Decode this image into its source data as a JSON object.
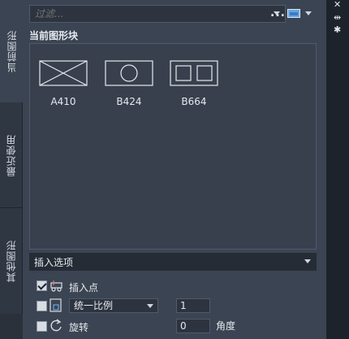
{
  "tabs": [
    "当前图形",
    "最近使用",
    "其他图形"
  ],
  "filter": {
    "placeholder": "过滤..."
  },
  "toolbar": {
    "more": "..."
  },
  "section_title": "当前图形块",
  "blocks": [
    {
      "name": "A410",
      "icon": "crossed-rectangle-icon"
    },
    {
      "name": "B424",
      "icon": "circle-in-rectangle-icon"
    },
    {
      "name": "B664",
      "icon": "two-squares-in-rectangle-icon"
    }
  ],
  "options": {
    "header": "插入选项",
    "insertion_point": {
      "label": "插入点",
      "checked": true
    },
    "scale": {
      "checked": false,
      "mode": "统一比例",
      "value": "1"
    },
    "rotation": {
      "checked": false,
      "label": "旋转",
      "value": "0",
      "angle_label": "角度"
    }
  },
  "colors": {
    "panel": "#3b4452",
    "strip": "#2a313b",
    "accent": "#6aa6e0"
  }
}
